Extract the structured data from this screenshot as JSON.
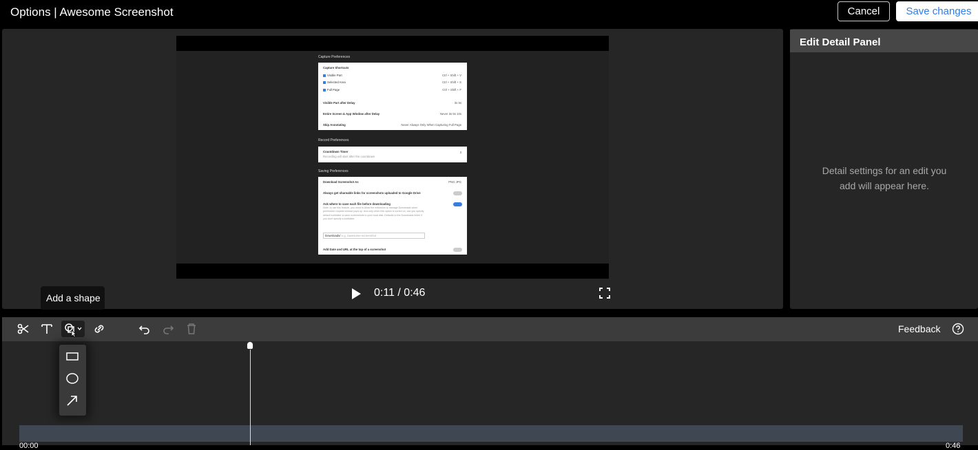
{
  "header": {
    "title": "Options | Awesome Screenshot",
    "cancel_label": "Cancel",
    "save_label": "Save changes"
  },
  "video": {
    "current_time": "0:11",
    "duration": "0:46",
    "time_display": "0:11 / 0:46",
    "content": {
      "capture_section": "Capture Preferences",
      "capture_shortcuts": "Capture Shortcuts",
      "shortcuts": [
        {
          "label": "Visible Part",
          "keys": "Ctrl + Shift + V"
        },
        {
          "label": "Selected Area",
          "keys": "Ctrl + Shift + S"
        },
        {
          "label": "Full Page",
          "keys": "Ctrl + Shift + F"
        }
      ],
      "visible_delay": "Visible Part after Delay",
      "visible_delay_opts": "3s   5s",
      "entire_delay": "Entire Screen & App Window after Delay",
      "entire_delay_opts": "Never  3s  5s  10s",
      "skip_annotating": "Skip Annotating",
      "skip_opts": "Never   Always   Only When Capturing Full Page",
      "record_section": "Record Preferences",
      "countdown": "Countdown Timer",
      "countdown_sub": "Recording will start after the countdown",
      "countdown_value": "3",
      "saving_section": "Saving Preferences",
      "download_as": "Download Screenshot As",
      "download_opts": "PNG   JPG",
      "shareable": "Always get shareable links for screenshots uploaded to Google Drive",
      "ask_where": "Ask where to save each file before downloading",
      "ask_note": "Note: to use this feature, you need to Allow the extension to manage Downloads when permission request window pops up. And only when this option is turned on, can you specify default subfolder to save screenshots to your local disk. Defaults to the Downloads folder if you don't specify a subfolder.",
      "folder_prefix": "Downloads/",
      "folder_placeholder": "e.g. /awesome-screenshot",
      "add_date": "Add Date and URL at the top of a screenshot"
    }
  },
  "edit_panel": {
    "title": "Edit Detail Panel",
    "hint_line1": "Detail settings for an edit you",
    "hint_line2": "add will appear here."
  },
  "tooltip": "Add a shape",
  "toolbar": {
    "feedback_label": "Feedback",
    "tools": [
      "scissors-icon",
      "text-icon",
      "shape-icon",
      "link-icon",
      "undo-icon",
      "redo-icon",
      "trash-icon"
    ]
  },
  "shape_menu": {
    "items": [
      "rectangle-icon",
      "ellipse-icon",
      "arrow-icon"
    ]
  },
  "timeline": {
    "start": "00:00",
    "end": "0:46",
    "playhead_fraction": 0.2391
  },
  "colors": {
    "accent": "#2f7ee7",
    "panel": "#262626",
    "toolbar": "#3c3c3c",
    "track": "#3f4852"
  }
}
